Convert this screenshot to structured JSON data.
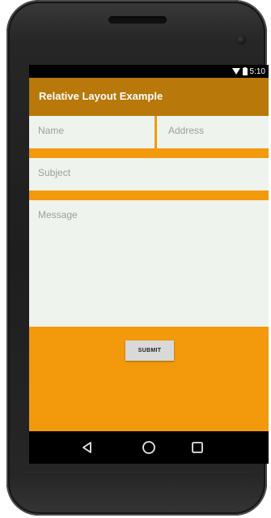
{
  "status_bar": {
    "time": "5:10",
    "icons": [
      "wifi-icon",
      "battery-icon"
    ]
  },
  "app_bar": {
    "title": "Relative Layout Example",
    "color": "#b8780a"
  },
  "form": {
    "name_placeholder": "Name",
    "address_placeholder": "Address",
    "subject_placeholder": "Subject",
    "message_placeholder": "Message",
    "submit_label": "SUBMIT"
  },
  "nav_bar": {
    "buttons": [
      "back-icon",
      "home-icon",
      "recents-icon"
    ]
  },
  "colors": {
    "background": "#f29a0c",
    "app_bar": "#b8780a",
    "field": "#eef3ee",
    "button": "#d9d9d9"
  }
}
